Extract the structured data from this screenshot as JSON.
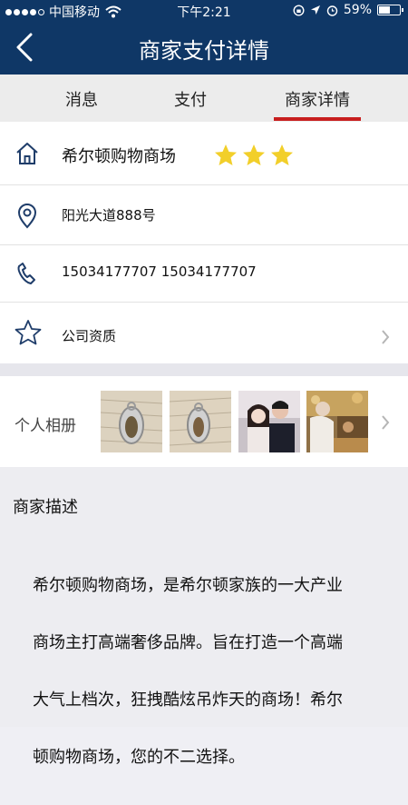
{
  "status_bar": {
    "carrier": "中国移动",
    "time": "下午2:21",
    "battery_percent": "59%",
    "battery_level": 0.59,
    "icons": [
      "signal-dots-icon",
      "wifi-icon",
      "lock-rotation-icon",
      "location-arrow-icon",
      "alarm-icon",
      "battery-icon"
    ]
  },
  "navbar": {
    "title": "商家支付详情",
    "back_icon": "chevron-left-icon",
    "color": "#0f3766"
  },
  "tabs": [
    {
      "label": "消息",
      "selected": false
    },
    {
      "label": "支付",
      "selected": false
    },
    {
      "label": "商家详情",
      "selected": true
    }
  ],
  "tab_indicator_color": "#c81e1e",
  "merchant": {
    "name": "希尔顿购物商场",
    "rating": 3,
    "star_color": "#f2cf2a",
    "address": "阳光大道888号",
    "phones": "15034177707  15034177707",
    "qualification_label": "公司资质",
    "icons": [
      "home-icon",
      "location-pin-icon",
      "phone-icon",
      "star-outline-icon",
      "chevron-right-icon"
    ]
  },
  "album": {
    "label": "个人相册",
    "photos": [
      "amulet-photo-1",
      "amulet-photo-2",
      "couple-photo",
      "blessing-ceremony-photo"
    ]
  },
  "description": {
    "title": "商家描述",
    "lines": [
      "希尔顿购物商场，是希尔顿家族的一大产业",
      "商场主打高端奢侈品牌。旨在打造一个高端",
      "大气上档次，狂拽酷炫吊炸天的商场！希尔",
      "顿购物商场，您的不二选择。"
    ]
  }
}
